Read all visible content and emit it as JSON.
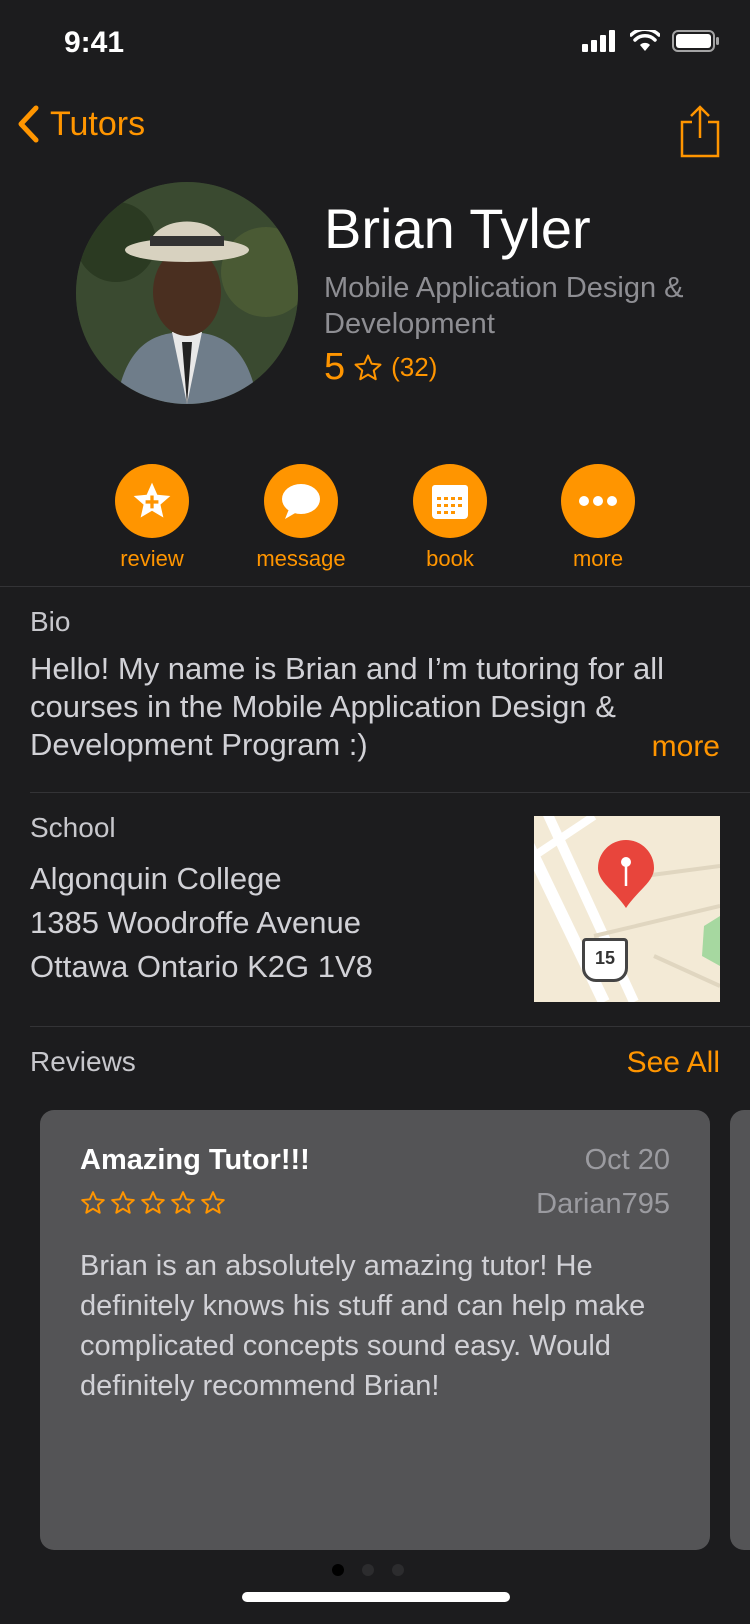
{
  "status_bar": {
    "time": "9:41"
  },
  "nav": {
    "back_label": "Tutors"
  },
  "profile": {
    "name": "Brian Tyler",
    "program": "Mobile Application Design & Development",
    "rating": "5",
    "rating_count": "(32)"
  },
  "actions": [
    {
      "label": "review",
      "icon": "star-plus-icon"
    },
    {
      "label": "message",
      "icon": "speech-bubble-icon"
    },
    {
      "label": "book",
      "icon": "calendar-icon"
    },
    {
      "label": "more",
      "icon": "ellipsis-icon"
    }
  ],
  "bio": {
    "label": "Bio",
    "text": "Hello! My name is Brian and I’m tutoring for all courses in the Mobile Application Design & Development Program :)",
    "more_label": "more"
  },
  "school": {
    "label": "School",
    "name": "Algonquin College",
    "street": "1385 Woodroffe Avenue",
    "city": "Ottawa Ontario K2G 1V8",
    "map_route": "15"
  },
  "reviews": {
    "label": "Reviews",
    "see_all_label": "See All",
    "items": [
      {
        "title": "Amazing Tutor!!!",
        "date": "Oct 20",
        "user": "Darian795",
        "stars": 5,
        "body": "Brian is an absolutely amazing tutor! He definitely knows his stuff and can help make complicated concepts sound easy. Would definitely recommend Brian!"
      }
    ],
    "page_index": 1,
    "page_count": 3
  },
  "colors": {
    "accent": "#ff9500",
    "background": "#1c1c1e",
    "card": "#545456"
  }
}
